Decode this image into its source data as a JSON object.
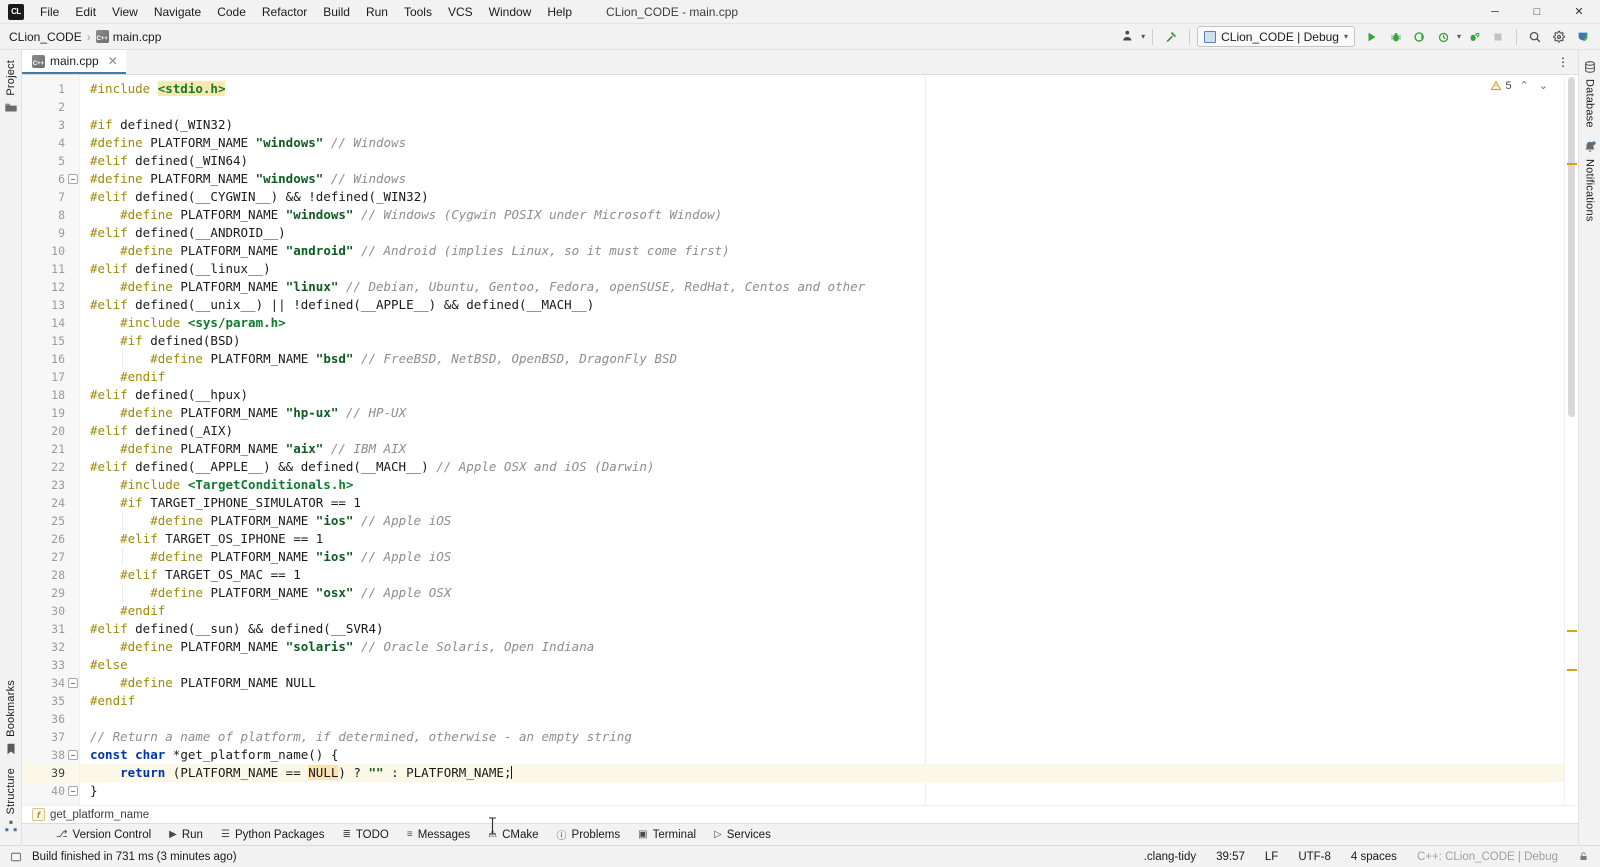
{
  "window": {
    "title": "CLion_CODE - main.cpp",
    "app_badge": "CL",
    "minimize": "─",
    "maximize": "□",
    "close": "✕"
  },
  "menubar": {
    "items": [
      {
        "label": "File"
      },
      {
        "label": "Edit"
      },
      {
        "label": "View"
      },
      {
        "label": "Navigate"
      },
      {
        "label": "Code"
      },
      {
        "label": "Refactor"
      },
      {
        "label": "Build"
      },
      {
        "label": "Run"
      },
      {
        "label": "Tools"
      },
      {
        "label": "VCS"
      },
      {
        "label": "Window"
      },
      {
        "label": "Help"
      }
    ]
  },
  "navbar": {
    "breadcrumbs": [
      {
        "label": "CLion_CODE",
        "icon": ""
      },
      {
        "label": "main.cpp",
        "icon": "cpp-file-icon"
      }
    ],
    "separator": "›",
    "run_config": {
      "label": "CLion_CODE | Debug",
      "icon": "run-config-icon",
      "caret": "⌄"
    },
    "actions": [
      {
        "name": "updates-icon",
        "glyph": "⬇"
      },
      {
        "name": "build-hammer-icon",
        "glyph": "⚒"
      },
      {
        "name": "run-icon",
        "glyph": "▶"
      },
      {
        "name": "debug-icon",
        "glyph": "🐞"
      },
      {
        "name": "run-with-coverage-icon",
        "glyph": "◔"
      },
      {
        "name": "profile-icon",
        "glyph": "⏱"
      },
      {
        "name": "attach-to-process-icon",
        "glyph": "↗"
      },
      {
        "name": "stop-icon",
        "glyph": "■"
      },
      {
        "name": "search-everywhere-icon",
        "glyph": "🔍"
      },
      {
        "name": "settings-gear-icon",
        "glyph": "⚙"
      },
      {
        "name": "account-icon",
        "glyph": "◕"
      }
    ]
  },
  "left_strip": {
    "top": [
      {
        "label": "Project",
        "icon": "project-folder-icon"
      }
    ],
    "bottom": [
      {
        "label": "Bookmarks",
        "icon": "bookmark-icon"
      },
      {
        "label": "Structure",
        "icon": "structure-icon"
      }
    ]
  },
  "right_strip": {
    "top": [
      {
        "label": "Database",
        "icon": "database-icon"
      },
      {
        "label": "Notifications",
        "icon": "notifications-bell-icon"
      }
    ]
  },
  "editor_tabs": {
    "tabs": [
      {
        "label": "main.cpp",
        "icon": "cpp-file-icon",
        "close": "✕",
        "active": true
      }
    ],
    "more": "⋮"
  },
  "inspections": {
    "warning_count": "5",
    "warning_icon": "warning-triangle-icon",
    "prev": "⌃",
    "next": "⌄"
  },
  "editor": {
    "first_line": 1,
    "current_line": 39,
    "lines": [
      {
        "n": 1,
        "fold": false,
        "tokens": [
          {
            "t": "#include ",
            "c": "t-dir"
          },
          {
            "t": "<stdio.h>",
            "c": "t-hdr-hl"
          }
        ]
      },
      {
        "n": 2,
        "fold": false,
        "tokens": []
      },
      {
        "n": 3,
        "fold": false,
        "tokens": [
          {
            "t": "#if ",
            "c": "t-dir"
          },
          {
            "t": "defined(_WIN32)",
            "c": "t-plain"
          }
        ]
      },
      {
        "n": 4,
        "fold": false,
        "tokens": [
          {
            "t": "#define ",
            "c": "t-dir"
          },
          {
            "t": "PLATFORM_NAME ",
            "c": "t-plain"
          },
          {
            "t": "\"windows\"",
            "c": "t-str"
          },
          {
            "t": " ",
            "c": "t-plain"
          },
          {
            "t": "// Windows",
            "c": "t-cmt"
          }
        ]
      },
      {
        "n": 5,
        "fold": false,
        "tokens": [
          {
            "t": "#elif ",
            "c": "t-dir"
          },
          {
            "t": "defined(_WIN64)",
            "c": "t-plain"
          }
        ]
      },
      {
        "n": 6,
        "fold": true,
        "tokens": [
          {
            "t": "#define ",
            "c": "t-dir"
          },
          {
            "t": "PLATFORM_NAME ",
            "c": "t-plain"
          },
          {
            "t": "\"windows\"",
            "c": "t-str"
          },
          {
            "t": " ",
            "c": "t-plain"
          },
          {
            "t": "// Windows",
            "c": "t-cmt"
          }
        ]
      },
      {
        "n": 7,
        "fold": false,
        "tokens": [
          {
            "t": "#elif ",
            "c": "t-dir"
          },
          {
            "t": "defined(__CYGWIN__) && !defined(_WIN32)",
            "c": "t-plain"
          }
        ]
      },
      {
        "n": 8,
        "fold": false,
        "tokens": [
          {
            "t": "    ",
            "c": "t-plain"
          },
          {
            "t": "#define ",
            "c": "t-dir"
          },
          {
            "t": "PLATFORM_NAME ",
            "c": "t-plain"
          },
          {
            "t": "\"windows\"",
            "c": "t-str"
          },
          {
            "t": " ",
            "c": "t-plain"
          },
          {
            "t": "// Windows (Cygwin POSIX under Microsoft Window)",
            "c": "t-cmt"
          }
        ]
      },
      {
        "n": 9,
        "fold": false,
        "tokens": [
          {
            "t": "#elif ",
            "c": "t-dir"
          },
          {
            "t": "defined(__ANDROID__)",
            "c": "t-plain"
          }
        ]
      },
      {
        "n": 10,
        "fold": false,
        "tokens": [
          {
            "t": "    ",
            "c": "t-plain"
          },
          {
            "t": "#define ",
            "c": "t-dir"
          },
          {
            "t": "PLATFORM_NAME ",
            "c": "t-plain"
          },
          {
            "t": "\"android\"",
            "c": "t-str"
          },
          {
            "t": " ",
            "c": "t-plain"
          },
          {
            "t": "// Android (implies Linux, so it must come first)",
            "c": "t-cmt"
          }
        ]
      },
      {
        "n": 11,
        "fold": false,
        "tokens": [
          {
            "t": "#elif ",
            "c": "t-dir"
          },
          {
            "t": "defined(__linux__)",
            "c": "t-plain"
          }
        ]
      },
      {
        "n": 12,
        "fold": false,
        "tokens": [
          {
            "t": "    ",
            "c": "t-plain"
          },
          {
            "t": "#define ",
            "c": "t-dir"
          },
          {
            "t": "PLATFORM_NAME ",
            "c": "t-plain"
          },
          {
            "t": "\"linux\"",
            "c": "t-str"
          },
          {
            "t": " ",
            "c": "t-plain"
          },
          {
            "t": "// Debian, Ubuntu, Gentoo, Fedora, openSUSE, RedHat, Centos and other",
            "c": "t-cmt"
          }
        ]
      },
      {
        "n": 13,
        "fold": false,
        "tokens": [
          {
            "t": "#elif ",
            "c": "t-dir"
          },
          {
            "t": "defined(__unix__) || !defined(__APPLE__) && defined(__MACH__)",
            "c": "t-plain"
          }
        ]
      },
      {
        "n": 14,
        "fold": false,
        "tokens": [
          {
            "t": "    ",
            "c": "t-plain"
          },
          {
            "t": "#include ",
            "c": "t-dir"
          },
          {
            "t": "<sys/param.h>",
            "c": "t-hdr"
          }
        ]
      },
      {
        "n": 15,
        "fold": false,
        "tokens": [
          {
            "t": "    ",
            "c": "t-plain"
          },
          {
            "t": "#if ",
            "c": "t-dir"
          },
          {
            "t": "defined(BSD)",
            "c": "t-plain"
          }
        ]
      },
      {
        "n": 16,
        "fold": false,
        "tokens": [
          {
            "t": "        ",
            "c": "t-plain"
          },
          {
            "t": "#define ",
            "c": "t-dir"
          },
          {
            "t": "PLATFORM_NAME ",
            "c": "t-plain"
          },
          {
            "t": "\"bsd\"",
            "c": "t-str"
          },
          {
            "t": " ",
            "c": "t-plain"
          },
          {
            "t": "// FreeBSD, NetBSD, OpenBSD, DragonFly BSD",
            "c": "t-cmt"
          }
        ]
      },
      {
        "n": 17,
        "fold": false,
        "tokens": [
          {
            "t": "    ",
            "c": "t-plain"
          },
          {
            "t": "#endif",
            "c": "t-dir"
          }
        ]
      },
      {
        "n": 18,
        "fold": false,
        "tokens": [
          {
            "t": "#elif ",
            "c": "t-dir"
          },
          {
            "t": "defined(__hpux)",
            "c": "t-plain"
          }
        ]
      },
      {
        "n": 19,
        "fold": false,
        "tokens": [
          {
            "t": "    ",
            "c": "t-plain"
          },
          {
            "t": "#define ",
            "c": "t-dir"
          },
          {
            "t": "PLATFORM_NAME ",
            "c": "t-plain"
          },
          {
            "t": "\"hp-ux\"",
            "c": "t-str"
          },
          {
            "t": " ",
            "c": "t-plain"
          },
          {
            "t": "// HP-UX",
            "c": "t-cmt"
          }
        ]
      },
      {
        "n": 20,
        "fold": false,
        "tokens": [
          {
            "t": "#elif ",
            "c": "t-dir"
          },
          {
            "t": "defined(_AIX)",
            "c": "t-plain"
          }
        ]
      },
      {
        "n": 21,
        "fold": false,
        "tokens": [
          {
            "t": "    ",
            "c": "t-plain"
          },
          {
            "t": "#define ",
            "c": "t-dir"
          },
          {
            "t": "PLATFORM_NAME ",
            "c": "t-plain"
          },
          {
            "t": "\"aix\"",
            "c": "t-str"
          },
          {
            "t": " ",
            "c": "t-plain"
          },
          {
            "t": "// IBM AIX",
            "c": "t-cmt"
          }
        ]
      },
      {
        "n": 22,
        "fold": false,
        "tokens": [
          {
            "t": "#elif ",
            "c": "t-dir"
          },
          {
            "t": "defined(__APPLE__) && defined(__MACH__) ",
            "c": "t-plain"
          },
          {
            "t": "// Apple OSX and iOS (Darwin)",
            "c": "t-cmt"
          }
        ]
      },
      {
        "n": 23,
        "fold": false,
        "tokens": [
          {
            "t": "    ",
            "c": "t-plain"
          },
          {
            "t": "#include ",
            "c": "t-dir"
          },
          {
            "t": "<TargetConditionals.h>",
            "c": "t-hdr"
          }
        ]
      },
      {
        "n": 24,
        "fold": false,
        "tokens": [
          {
            "t": "    ",
            "c": "t-plain"
          },
          {
            "t": "#if ",
            "c": "t-dir"
          },
          {
            "t": "TARGET_IPHONE_SIMULATOR == 1",
            "c": "t-plain"
          }
        ]
      },
      {
        "n": 25,
        "fold": false,
        "tokens": [
          {
            "t": "        ",
            "c": "t-plain"
          },
          {
            "t": "#define ",
            "c": "t-dir"
          },
          {
            "t": "PLATFORM_NAME ",
            "c": "t-plain"
          },
          {
            "t": "\"ios\"",
            "c": "t-str"
          },
          {
            "t": " ",
            "c": "t-plain"
          },
          {
            "t": "// Apple iOS",
            "c": "t-cmt"
          }
        ]
      },
      {
        "n": 26,
        "fold": false,
        "tokens": [
          {
            "t": "    ",
            "c": "t-plain"
          },
          {
            "t": "#elif ",
            "c": "t-dir"
          },
          {
            "t": "TARGET_OS_IPHONE == 1",
            "c": "t-plain"
          }
        ]
      },
      {
        "n": 27,
        "fold": false,
        "tokens": [
          {
            "t": "        ",
            "c": "t-plain"
          },
          {
            "t": "#define ",
            "c": "t-dir"
          },
          {
            "t": "PLATFORM_NAME ",
            "c": "t-plain"
          },
          {
            "t": "\"ios\"",
            "c": "t-str"
          },
          {
            "t": " ",
            "c": "t-plain"
          },
          {
            "t": "// Apple iOS",
            "c": "t-cmt"
          }
        ]
      },
      {
        "n": 28,
        "fold": false,
        "tokens": [
          {
            "t": "    ",
            "c": "t-plain"
          },
          {
            "t": "#elif ",
            "c": "t-dir"
          },
          {
            "t": "TARGET_OS_MAC == 1",
            "c": "t-plain"
          }
        ]
      },
      {
        "n": 29,
        "fold": false,
        "tokens": [
          {
            "t": "        ",
            "c": "t-plain"
          },
          {
            "t": "#define ",
            "c": "t-dir"
          },
          {
            "t": "PLATFORM_NAME ",
            "c": "t-plain"
          },
          {
            "t": "\"osx\"",
            "c": "t-str"
          },
          {
            "t": " ",
            "c": "t-plain"
          },
          {
            "t": "// Apple OSX",
            "c": "t-cmt"
          }
        ]
      },
      {
        "n": 30,
        "fold": false,
        "tokens": [
          {
            "t": "    ",
            "c": "t-plain"
          },
          {
            "t": "#endif",
            "c": "t-dir"
          }
        ]
      },
      {
        "n": 31,
        "fold": false,
        "tokens": [
          {
            "t": "#elif ",
            "c": "t-dir"
          },
          {
            "t": "defined(__sun) && defined(__SVR4)",
            "c": "t-plain"
          }
        ]
      },
      {
        "n": 32,
        "fold": false,
        "tokens": [
          {
            "t": "    ",
            "c": "t-plain"
          },
          {
            "t": "#define ",
            "c": "t-dir"
          },
          {
            "t": "PLATFORM_NAME ",
            "c": "t-plain"
          },
          {
            "t": "\"solaris\"",
            "c": "t-str"
          },
          {
            "t": " ",
            "c": "t-plain"
          },
          {
            "t": "// Oracle Solaris, Open Indiana",
            "c": "t-cmt"
          }
        ]
      },
      {
        "n": 33,
        "fold": false,
        "tokens": [
          {
            "t": "#else",
            "c": "t-dir"
          }
        ]
      },
      {
        "n": 34,
        "fold": true,
        "tokens": [
          {
            "t": "    ",
            "c": "t-plain"
          },
          {
            "t": "#define ",
            "c": "t-dir"
          },
          {
            "t": "PLATFORM_NAME NULL",
            "c": "t-plain"
          }
        ]
      },
      {
        "n": 35,
        "fold": false,
        "tokens": [
          {
            "t": "#endif",
            "c": "t-dir"
          }
        ]
      },
      {
        "n": 36,
        "fold": false,
        "tokens": []
      },
      {
        "n": 37,
        "fold": false,
        "tokens": [
          {
            "t": "// Return a name of platform, if determined, otherwise - an empty string",
            "c": "t-cmt"
          }
        ]
      },
      {
        "n": 38,
        "fold": true,
        "tokens": [
          {
            "t": "const char",
            "c": "t-kw"
          },
          {
            "t": " *get_platform_name() {",
            "c": "t-plain"
          }
        ]
      },
      {
        "n": 39,
        "fold": false,
        "tokens": [
          {
            "t": "    ",
            "c": "t-plain"
          },
          {
            "t": "return",
            "c": "t-kw"
          },
          {
            "t": " (PLATFORM_NAME == ",
            "c": "t-plain"
          },
          {
            "t": "NULL",
            "c": "t-hl"
          },
          {
            "t": ") ? ",
            "c": "t-plain"
          },
          {
            "t": "\"\"",
            "c": "t-str"
          },
          {
            "t": " : PLATFORM_NAME;",
            "c": "t-plain"
          }
        ]
      },
      {
        "n": 40,
        "fold": true,
        "tokens": [
          {
            "t": "}",
            "c": "t-plain"
          }
        ]
      }
    ]
  },
  "breadcrumb_bar": {
    "badge": "f",
    "label": "get_platform_name"
  },
  "tool_windows": [
    {
      "label": "Version Control",
      "icon": "branch-icon",
      "glyph": "⎇"
    },
    {
      "label": "Run",
      "icon": "run-icon",
      "glyph": "▶"
    },
    {
      "label": "Python Packages",
      "icon": "python-packages-icon",
      "glyph": "☰"
    },
    {
      "label": "TODO",
      "icon": "todo-list-icon",
      "glyph": "≣"
    },
    {
      "label": "Messages",
      "icon": "messages-icon",
      "glyph": "≡"
    },
    {
      "label": "CMake",
      "icon": "cmake-triangle-icon",
      "glyph": "⚠"
    },
    {
      "label": "Problems",
      "icon": "problems-icon",
      "glyph": "ⓘ"
    },
    {
      "label": "Terminal",
      "icon": "terminal-icon",
      "glyph": "▣"
    },
    {
      "label": "Services",
      "icon": "services-icon",
      "glyph": "▷"
    }
  ],
  "statusbar": {
    "build_icon": "build-status-icon",
    "build_message": "Build finished in 731 ms (3 minutes ago)",
    "right": {
      "inspection_profile": ".clang-tidy",
      "caret_position": "39:57",
      "line_separator": "LF",
      "encoding": "UTF-8",
      "indent": "4 spaces",
      "language_config": "C++: CLion_CODE | Debug",
      "lock_icon": "lock-icon"
    }
  },
  "colors": {
    "accent_blue": "#3d7ab5",
    "run_green": "#3aa33a",
    "chrome_bg": "#f2f2f2",
    "editor_bg": "#ffffff",
    "current_line_bg": "#fcf8e8",
    "highlight_bg": "#fbe3b4",
    "keyword": "#0033b3",
    "string": "#0b5d1e",
    "comment": "#8d8d8d",
    "directive": "#9e880d"
  }
}
